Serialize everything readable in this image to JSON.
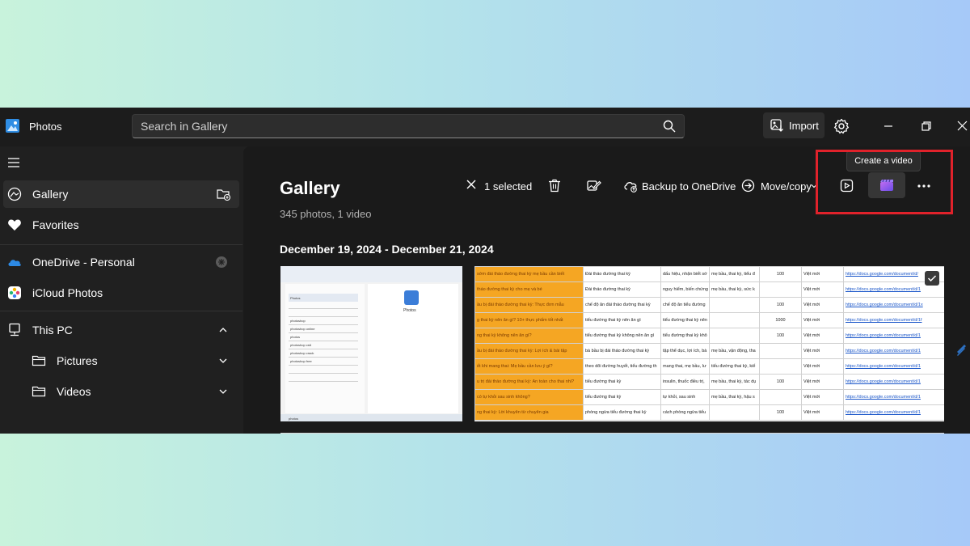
{
  "app": {
    "title": "Photos",
    "search_placeholder": "Search in Gallery",
    "import_label": "Import"
  },
  "sidebar": {
    "items": [
      {
        "label": "Gallery",
        "icon": "gallery-icon"
      },
      {
        "label": "Favorites",
        "icon": "heart-icon"
      },
      {
        "label": "OneDrive - Personal",
        "icon": "cloud-icon"
      },
      {
        "label": "iCloud Photos",
        "icon": "icloud-icon"
      },
      {
        "label": "This PC",
        "icon": "pc-icon"
      },
      {
        "label": "Pictures",
        "icon": "folder-icon"
      },
      {
        "label": "Videos",
        "icon": "folder-icon"
      }
    ]
  },
  "main": {
    "title": "Gallery",
    "subtitle": "345 photos, 1 video",
    "toolbar": {
      "selected": "1 selected",
      "backup": "Backup to OneDrive",
      "move_copy": "Move/copy"
    },
    "tooltip": "Create a video",
    "date_range": "December 19, 2024 - December 21, 2024"
  },
  "colors": {
    "highlight": "#e0222b",
    "window_bg": "#202020",
    "sheet_orange": "#f5a623"
  },
  "thumb1": {
    "search_text": "photos",
    "app_name": "Photos",
    "list": [
      "Photos",
      "photoshop",
      "photoshop online",
      "photos",
      "photoshop cs6",
      "photoshop crack",
      "photoshop free"
    ]
  },
  "sheet": {
    "rows": [
      [
        "sớm đái tháo đường thai kỳ mẹ bầu cần biết",
        "Đái tháo đường thai kỳ",
        "dấu hiệu, nhận biết sớ",
        "mẹ bầu, thai kỳ, tiểu đ",
        "100",
        "Việt mới",
        "https://docs.google.com/document/d/"
      ],
      [
        "tháo đường thai kỳ cho mẹ và bé",
        "Đái tháo đường thai kỳ",
        "nguy hiểm, biến chứng",
        "mẹ bầu, thai kỳ, sức k",
        "",
        "Việt mới",
        "https://docs.google.com/document/d/1"
      ],
      [
        "ầu bị đái tháo đường thai kỳ: Thực đơn mẫu",
        "chế độ ăn đái tháo đường thai kỳ",
        "chế độ ăn tiểu đường",
        "",
        "100",
        "Việt mới",
        "https://docs.google.com/document/d/1x"
      ],
      [
        "g thai kỳ nên ăn gì? 10+ thực phẩm tốt nhất",
        "tiểu đường thai kỳ nên ăn gì",
        "tiểu đường thai kỳ nên",
        "",
        "1000",
        "Việt mới",
        "https://docs.google.com/document/d/1f"
      ],
      [
        "ng thai kỳ không nên ăn gì?",
        "tiểu đường thai kỳ không nên ăn gì",
        "tiểu đường thai kỳ khô",
        "",
        "100",
        "Việt mới",
        "https://docs.google.com/document/d/1"
      ],
      [
        "ầu bị đái tháo đường thai kỳ: Lợi ích & bài tập",
        "bà bầu bị đái tháo đường thai kỳ",
        "tập thể dục, lợi ích, bà",
        "mẹ bầu, vận động, tha",
        "",
        "Việt mới",
        "https://docs.google.com/document/d/1"
      ],
      [
        "ết khi mang thai: Mẹ bầu cần lưu ý gì?",
        "theo dõi đường huyết, tiểu đường th",
        "mang thai, mẹ bầu, lư",
        "tiểu đường thai kỳ, kiể",
        "",
        "Việt mới",
        "https://docs.google.com/document/d/1"
      ],
      [
        "u trị đái tháo đường thai kỳ: An toàn cho thai nhi?",
        "tiểu đường thai kỳ",
        "insulin, thuốc điều trị,",
        "mẹ bầu, thai kỳ, tác dụ",
        "100",
        "Việt mới",
        "https://docs.google.com/document/d/1"
      ],
      [
        "có tự khỏi sau sinh không?",
        "tiểu đường thai kỳ",
        "tự khỏi, sau sinh",
        "mẹ bầu, thai kỳ, hậu s",
        "",
        "Việt mới",
        "https://docs.google.com/document/d/1"
      ],
      [
        "ng thai kỳ: Lời khuyên từ chuyên gia",
        "phòng ngừa tiểu đường thai kỳ",
        "cách phòng ngừa tiểu",
        "",
        "100",
        "Việt mới",
        "https://docs.google.com/document/d/1"
      ]
    ]
  }
}
